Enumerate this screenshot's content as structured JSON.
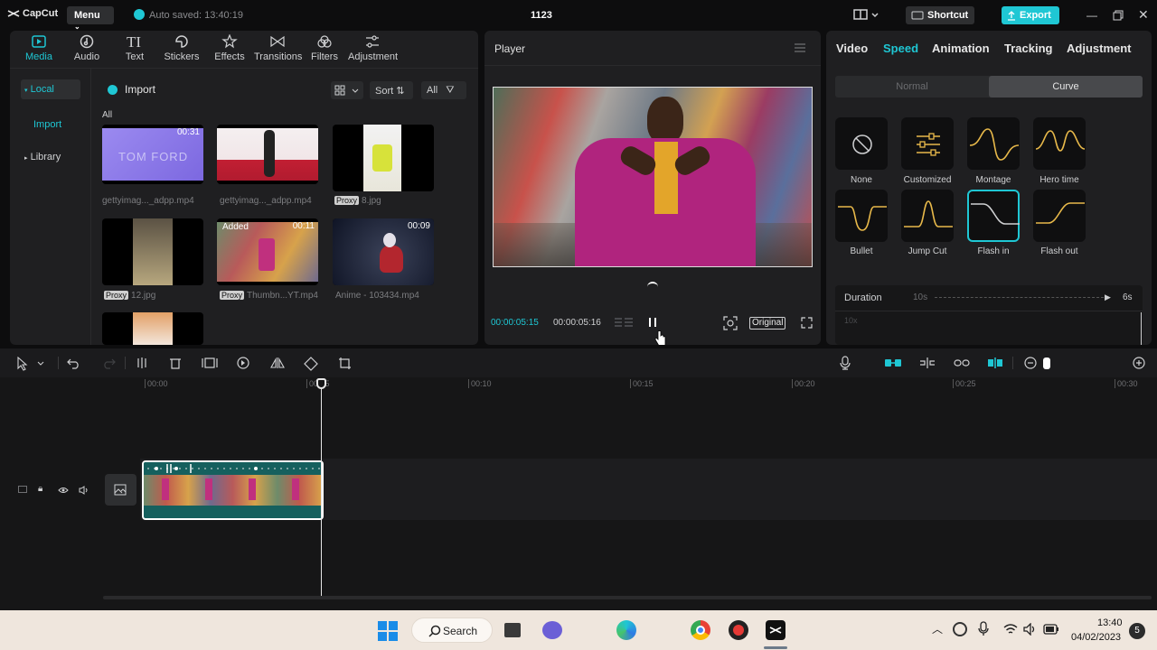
{
  "titlebar": {
    "logo": "CapCut",
    "menu": "Menu",
    "autosave": "Auto saved: 13:40:19",
    "project_title": "1123",
    "shortcut": "Shortcut",
    "export": "Export"
  },
  "media_panel": {
    "tabs": [
      {
        "label": "Media",
        "icon": "media-icon"
      },
      {
        "label": "Audio",
        "icon": "audio-icon"
      },
      {
        "label": "Text",
        "icon": "text-icon"
      },
      {
        "label": "Stickers",
        "icon": "stickers-icon"
      },
      {
        "label": "Effects",
        "icon": "effects-icon"
      },
      {
        "label": "Transitions",
        "icon": "transitions-icon"
      },
      {
        "label": "Filters",
        "icon": "filters-icon"
      },
      {
        "label": "Adjustment",
        "icon": "adjustment-icon"
      }
    ],
    "sidebar": {
      "local": "Local",
      "import": "Import",
      "library": "Library"
    },
    "import_button": "Import",
    "sort": "Sort",
    "filter_all": "All",
    "section_label": "All",
    "items": [
      {
        "caption": "gettyimag..._adpp.mp4",
        "duration": "00:31",
        "thumb_text": "TOM FORD",
        "proxy": ""
      },
      {
        "caption": "gettyimag..._adpp.mp4",
        "duration": "",
        "thumb_text": "",
        "proxy": ""
      },
      {
        "caption": "8.jpg",
        "duration": "",
        "thumb_text": "",
        "proxy": "Proxy"
      },
      {
        "caption": "12.jpg",
        "duration": "",
        "thumb_text": "",
        "proxy": "Proxy"
      },
      {
        "caption": "Thumbn...YT.mp4",
        "duration": "00:11",
        "thumb_text": "Added",
        "proxy": "Proxy"
      },
      {
        "caption": "Anime - 103434.mp4",
        "duration": "00:09",
        "thumb_text": "",
        "proxy": ""
      }
    ]
  },
  "player": {
    "title": "Player",
    "current_time": "00:00:05:15",
    "total_time": "00:00:05:16",
    "ratio": "Original"
  },
  "inspector": {
    "tabs": [
      "Video",
      "Speed",
      "Animation",
      "Tracking",
      "Adjustment"
    ],
    "active_tab": "Speed",
    "modes": [
      "Normal",
      "Curve"
    ],
    "active_mode": "Curve",
    "curves": [
      {
        "label": "None",
        "icon": "none-icon"
      },
      {
        "label": "Customized",
        "icon": "customized-icon"
      },
      {
        "label": "Montage",
        "icon": "montage-curve"
      },
      {
        "label": "Hero time",
        "icon": "hero-time-curve"
      },
      {
        "label": "Bullet",
        "icon": "bullet-curve"
      },
      {
        "label": "Jump Cut",
        "icon": "jump-cut-curve"
      },
      {
        "label": "Flash in",
        "icon": "flash-in-curve"
      },
      {
        "label": "Flash out",
        "icon": "flash-out-curve"
      }
    ],
    "selected_curve": "Flash in",
    "duration_label": "Duration",
    "duration_min": "10s",
    "duration_max": "6s",
    "graph_label": "10x"
  },
  "timeline": {
    "ruler": [
      "00:00",
      "00:05",
      "00:10",
      "00:15",
      "00:20",
      "00:25",
      "00:30"
    ]
  },
  "taskbar": {
    "search": "Search",
    "time": "13:40",
    "date": "04/02/2023",
    "notifications": "5"
  },
  "colors": {
    "accent": "#1fc7d4",
    "curve": "#e8b94a",
    "bg": "#0d0d0e",
    "panel": "#1f1f21"
  }
}
